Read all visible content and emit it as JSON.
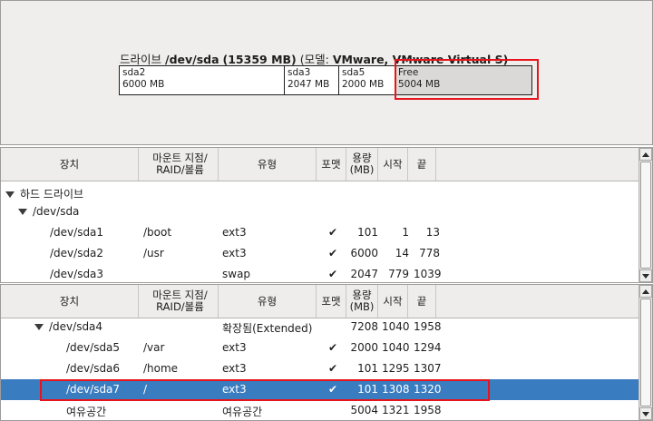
{
  "disk": {
    "label": "드라이브",
    "device": "/dev/sda",
    "size": "(15359 MB)",
    "model_label": "(모델:",
    "model_value": "VMware, VMware Virtual S)",
    "segments": [
      {
        "name": "sda2",
        "size": "6000 MB"
      },
      {
        "name": "sda3",
        "size": "2047 MB"
      },
      {
        "name": "sda5",
        "size": "2000 MB"
      },
      {
        "name": "Free",
        "size": "5004 MB"
      }
    ]
  },
  "columns": {
    "device": "장치",
    "mount": "마운트 지점/ RAID/볼륨",
    "type": "유형",
    "format": "포맷",
    "size": "용량 (MB)",
    "start": "시작",
    "end": "끝"
  },
  "table1": {
    "rows": [
      {
        "device": "하드 드라이브",
        "mount": "",
        "type": "",
        "format": "",
        "size": "",
        "start": "",
        "end": ""
      },
      {
        "device": "/dev/sda",
        "mount": "",
        "type": "",
        "format": "",
        "size": "",
        "start": "",
        "end": ""
      },
      {
        "device": "/dev/sda1",
        "mount": "/boot",
        "type": "ext3",
        "format": "✔",
        "size": "101",
        "start": "1",
        "end": "13"
      },
      {
        "device": "/dev/sda2",
        "mount": "/usr",
        "type": "ext3",
        "format": "✔",
        "size": "6000",
        "start": "14",
        "end": "778"
      },
      {
        "device": "/dev/sda3",
        "mount": "",
        "type": "swap",
        "format": "✔",
        "size": "2047",
        "start": "779",
        "end": "1039"
      }
    ]
  },
  "table2": {
    "rows": [
      {
        "device": "/dev/sda4",
        "mount": "",
        "type": "확장됨(Extended)",
        "format": "",
        "size": "7208",
        "start": "1040",
        "end": "1958"
      },
      {
        "device": "/dev/sda5",
        "mount": "/var",
        "type": "ext3",
        "format": "✔",
        "size": "2000",
        "start": "1040",
        "end": "1294"
      },
      {
        "device": "/dev/sda6",
        "mount": "/home",
        "type": "ext3",
        "format": "✔",
        "size": "101",
        "start": "1295",
        "end": "1307"
      },
      {
        "device": "/dev/sda7",
        "mount": "/",
        "type": "ext3",
        "format": "✔",
        "size": "101",
        "start": "1308",
        "end": "1320"
      },
      {
        "device": "여유공간",
        "mount": "",
        "type": "여유공간",
        "format": "",
        "size": "5004",
        "start": "1321",
        "end": "1958"
      }
    ]
  },
  "colors": {
    "selection": "#3a7cc0",
    "highlight_outline": "#e8141b",
    "free_segment": "#dad9d7"
  }
}
